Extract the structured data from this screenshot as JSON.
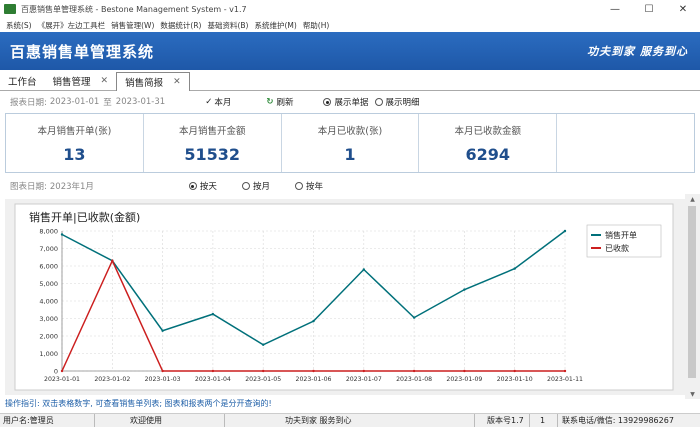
{
  "window": {
    "title": "百惠销售单管理系统 - Bestone Management System - v1.7"
  },
  "menu": [
    "系统(S)",
    "《展开》左边工具栏",
    "销售管理(W)",
    "数据统计(R)",
    "基础资料(B)",
    "系统维护(M)",
    "帮助(H)"
  ],
  "banner": {
    "system_name": "百惠销售单管理系统",
    "slogan": "功夫到家 服务到心"
  },
  "tabs": [
    {
      "label": "工作台",
      "closable": false
    },
    {
      "label": "销售管理",
      "closable": true
    },
    {
      "label": "销售简报",
      "closable": true,
      "active": true
    }
  ],
  "filters": {
    "report_date_label": "报表日期:",
    "start_date": "2023-01-01",
    "range_sep": "至",
    "end_date": "2023-01-31",
    "this_month": "本月",
    "refresh": "刷新",
    "show_doc": "展示单据",
    "show_detail": "展示明细",
    "selected": "show_doc"
  },
  "summary": [
    {
      "label": "本月销售开单(张)",
      "value": "13"
    },
    {
      "label": "本月销售开金额",
      "value": "51532"
    },
    {
      "label": "本月已收款(张)",
      "value": "1"
    },
    {
      "label": "本月已收款金额",
      "value": "6294"
    }
  ],
  "chart_date": {
    "label": "图表日期:",
    "value": "2023年1月",
    "options": [
      "按天",
      "按月",
      "按年"
    ],
    "selected": "按天"
  },
  "chart_data": {
    "type": "line",
    "title": "销售开单|已收款(金额)",
    "categories": [
      "2023-01-01",
      "2023-01-02",
      "2023-01-03",
      "2023-01-04",
      "2023-01-05",
      "2023-01-06",
      "2023-01-07",
      "2023-01-08",
      "2023-01-09",
      "2023-01-10",
      "2023-01-11"
    ],
    "series": [
      {
        "name": "销售开单",
        "color": "#00707a",
        "values": [
          7800,
          6300,
          2300,
          3250,
          1500,
          2850,
          5800,
          3050,
          4650,
          5850,
          8000
        ]
      },
      {
        "name": "已收款",
        "color": "#cc1f1f",
        "values": [
          0,
          6300,
          0,
          0,
          0,
          0,
          0,
          0,
          0,
          0,
          0
        ]
      }
    ],
    "ylim": [
      0,
      8000
    ],
    "yticks": [
      "0",
      "1,000",
      "2,000",
      "3,000",
      "4,000",
      "5,000",
      "6,000",
      "7,000",
      "8,000"
    ],
    "grid": true,
    "legend": "right"
  },
  "hint": "操作指引: 双击表格数字, 可查看销售单列表; 图表和报表两个是分开查询的!",
  "status": {
    "user": "用户名:管理员",
    "welcome": "欢迎使用",
    "slogan": "功夫到家 服务到心",
    "version": "版本号1.7",
    "count": "1",
    "contact": "联系电话/微信: 13929986267"
  }
}
